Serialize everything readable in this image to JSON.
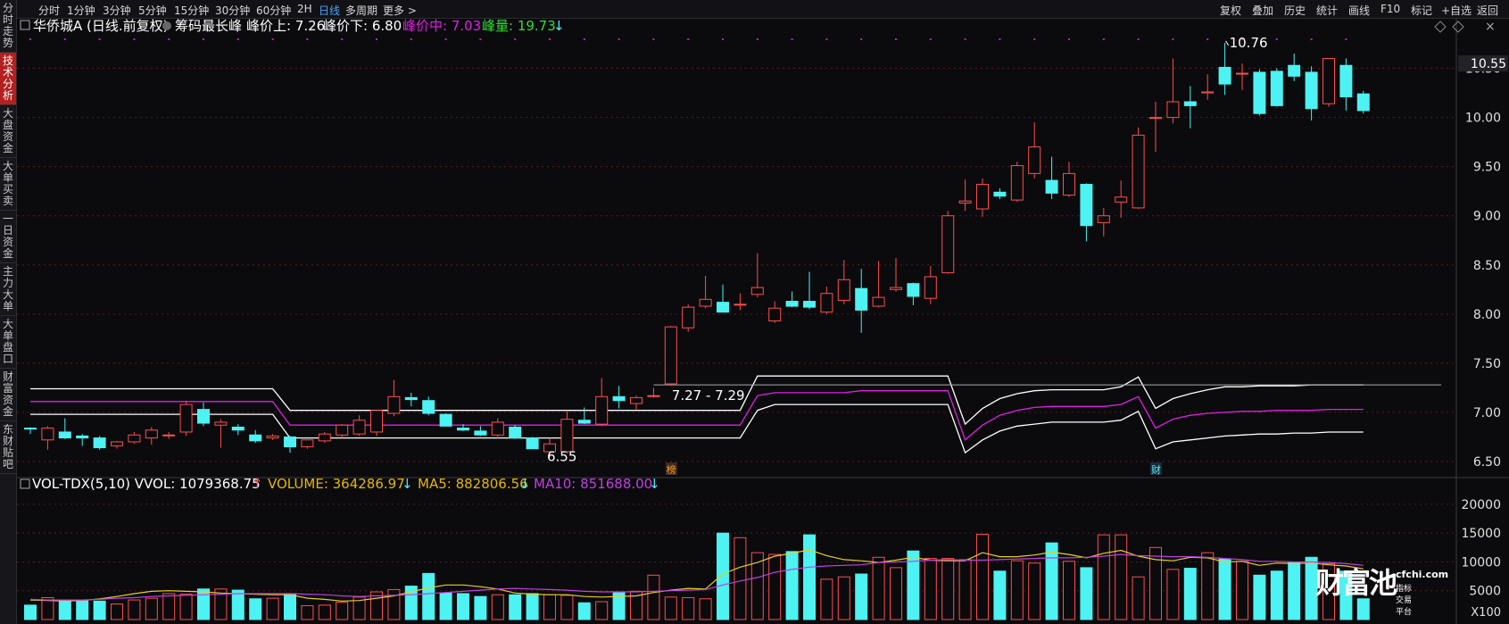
{
  "sidebar": {
    "tabs": [
      {
        "label": "分时走势",
        "active": false
      },
      {
        "label": "技术分析",
        "active": true
      },
      {
        "label": "大盘资金",
        "active": false
      },
      {
        "label": "大单买卖",
        "active": false
      },
      {
        "label": "一日资金",
        "active": false
      },
      {
        "label": "主力大单",
        "active": false
      },
      {
        "label": "大单盘口",
        "active": false
      },
      {
        "label": "财富资金",
        "active": false
      },
      {
        "label": "东财贴吧",
        "active": false
      }
    ]
  },
  "toolbar": {
    "periods": [
      "分时",
      "1分钟",
      "3分钟",
      "5分钟",
      "15分钟",
      "30分钟",
      "60分钟",
      "2H",
      "日线",
      "多周期",
      "更多 >"
    ],
    "active_period": "日线",
    "right_items": [
      "复权",
      "叠加",
      "历史",
      "统计",
      "画线",
      "F10",
      "标记",
      "+自选",
      "返回"
    ]
  },
  "main_header": {
    "stock": "华侨城A (日线.前复权)",
    "indicator": "筹码最长峰",
    "upper_label": "峰价上: 7.26",
    "lower_label": "峰价下: 6.80",
    "mid_label": "峰价中: 7.03",
    "volume_label": "峰量: 19.73",
    "arrow": "↓"
  },
  "annotations": {
    "high_label": "10.76",
    "low_label": "6.55",
    "range_label": "7.27 - 7.29",
    "event1": "榜",
    "event2": "财",
    "current_price": "10.55"
  },
  "price_axis": [
    "10.50",
    "10.00",
    "9.50",
    "9.00",
    "8.50",
    "8.00",
    "7.50",
    "7.00",
    "6.50"
  ],
  "volume_header": {
    "name": "VOL-TDX(5,10) VVOL: 1079368.75",
    "arrow1": "↑",
    "volume": "VOLUME: 364286.97",
    "arrow2": "↓",
    "ma5": "MA5: 882806.56",
    "arrow3": "↓",
    "ma10": "MA10: 851688.00",
    "arrow4": "↓"
  },
  "volume_axis": [
    "20000",
    "15000",
    "10000",
    "5000",
    "X100"
  ],
  "watermark": {
    "main": "财富池",
    "site": "cfchi.com",
    "sub": "指标交易平台"
  },
  "colors": {
    "up": "#ff4d4d",
    "down": "#4df2f2",
    "mid": "#e020e0",
    "band": "#ffffff",
    "ma5": "#e6d020",
    "ma10": "#c040e0",
    "volume_header": "#e6b800",
    "accent": "#49a3ff"
  },
  "chart_data": {
    "type": "candlestick",
    "ylim": [
      6.4,
      10.85
    ],
    "candles": [
      {
        "o": 6.84,
        "h": 6.85,
        "l": 6.78,
        "c": 6.83
      },
      {
        "o": 6.72,
        "h": 6.86,
        "l": 6.62,
        "c": 6.84
      },
      {
        "o": 6.8,
        "h": 6.94,
        "l": 6.73,
        "c": 6.74
      },
      {
        "o": 6.76,
        "h": 6.78,
        "l": 6.66,
        "c": 6.74
      },
      {
        "o": 6.74,
        "h": 6.76,
        "l": 6.62,
        "c": 6.64
      },
      {
        "o": 6.66,
        "h": 6.71,
        "l": 6.63,
        "c": 6.7
      },
      {
        "o": 6.7,
        "h": 6.8,
        "l": 6.68,
        "c": 6.77
      },
      {
        "o": 6.74,
        "h": 6.85,
        "l": 6.67,
        "c": 6.82
      },
      {
        "o": 6.77,
        "h": 6.8,
        "l": 6.73,
        "c": 6.77
      },
      {
        "o": 6.8,
        "h": 7.12,
        "l": 6.76,
        "c": 7.08
      },
      {
        "o": 7.03,
        "h": 7.1,
        "l": 6.86,
        "c": 6.89
      },
      {
        "o": 6.87,
        "h": 6.93,
        "l": 6.64,
        "c": 6.9
      },
      {
        "o": 6.85,
        "h": 6.88,
        "l": 6.77,
        "c": 6.82
      },
      {
        "o": 6.77,
        "h": 6.82,
        "l": 6.69,
        "c": 6.71
      },
      {
        "o": 6.74,
        "h": 6.78,
        "l": 6.72,
        "c": 6.76
      },
      {
        "o": 6.75,
        "h": 6.76,
        "l": 6.59,
        "c": 6.65
      },
      {
        "o": 6.65,
        "h": 6.72,
        "l": 6.63,
        "c": 6.72
      },
      {
        "o": 6.71,
        "h": 6.8,
        "l": 6.69,
        "c": 6.78
      },
      {
        "o": 6.77,
        "h": 6.88,
        "l": 6.74,
        "c": 6.87
      },
      {
        "o": 6.78,
        "h": 6.97,
        "l": 6.76,
        "c": 6.92
      },
      {
        "o": 6.8,
        "h": 7.02,
        "l": 6.76,
        "c": 7.02
      },
      {
        "o": 6.99,
        "h": 7.33,
        "l": 6.96,
        "c": 7.16
      },
      {
        "o": 7.15,
        "h": 7.2,
        "l": 7.06,
        "c": 7.13
      },
      {
        "o": 7.12,
        "h": 7.16,
        "l": 6.97,
        "c": 6.99
      },
      {
        "o": 6.98,
        "h": 6.99,
        "l": 6.86,
        "c": 6.86
      },
      {
        "o": 6.84,
        "h": 6.88,
        "l": 6.81,
        "c": 6.82
      },
      {
        "o": 6.81,
        "h": 6.86,
        "l": 6.76,
        "c": 6.77
      },
      {
        "o": 6.77,
        "h": 6.94,
        "l": 6.73,
        "c": 6.9
      },
      {
        "o": 6.85,
        "h": 6.87,
        "l": 6.73,
        "c": 6.74
      },
      {
        "o": 6.74,
        "h": 6.75,
        "l": 6.63,
        "c": 6.63
      },
      {
        "o": 6.6,
        "h": 6.74,
        "l": 6.55,
        "c": 6.68
      },
      {
        "o": 6.6,
        "h": 7.02,
        "l": 6.58,
        "c": 6.93
      },
      {
        "o": 6.92,
        "h": 7.05,
        "l": 6.88,
        "c": 6.89
      },
      {
        "o": 6.88,
        "h": 7.35,
        "l": 6.86,
        "c": 7.16
      },
      {
        "o": 7.16,
        "h": 7.27,
        "l": 7.04,
        "c": 7.12
      },
      {
        "o": 7.09,
        "h": 7.17,
        "l": 7.03,
        "c": 7.15
      },
      {
        "o": 7.17,
        "h": 7.25,
        "l": 7.15,
        "c": 7.17
      },
      {
        "o": 7.29,
        "h": 7.88,
        "l": 7.27,
        "c": 7.87
      },
      {
        "o": 7.86,
        "h": 8.1,
        "l": 7.82,
        "c": 8.07
      },
      {
        "o": 8.08,
        "h": 8.39,
        "l": 8.06,
        "c": 8.15
      },
      {
        "o": 8.12,
        "h": 8.3,
        "l": 8.03,
        "c": 8.02
      },
      {
        "o": 8.1,
        "h": 8.21,
        "l": 8.04,
        "c": 8.1
      },
      {
        "o": 8.2,
        "h": 8.62,
        "l": 8.17,
        "c": 8.27
      },
      {
        "o": 7.93,
        "h": 8.13,
        "l": 7.91,
        "c": 8.06
      },
      {
        "o": 8.13,
        "h": 8.23,
        "l": 8.07,
        "c": 8.08
      },
      {
        "o": 8.13,
        "h": 8.43,
        "l": 8.05,
        "c": 8.07
      },
      {
        "o": 8.02,
        "h": 8.28,
        "l": 8.0,
        "c": 8.21
      },
      {
        "o": 8.14,
        "h": 8.55,
        "l": 8.1,
        "c": 8.35
      },
      {
        "o": 8.26,
        "h": 8.46,
        "l": 7.81,
        "c": 8.04
      },
      {
        "o": 8.08,
        "h": 8.54,
        "l": 8.07,
        "c": 8.17
      },
      {
        "o": 8.25,
        "h": 8.57,
        "l": 8.23,
        "c": 8.27
      },
      {
        "o": 8.31,
        "h": 8.32,
        "l": 8.09,
        "c": 8.18
      },
      {
        "o": 8.16,
        "h": 8.49,
        "l": 8.1,
        "c": 8.38
      },
      {
        "o": 8.42,
        "h": 9.05,
        "l": 8.41,
        "c": 9.0
      },
      {
        "o": 9.13,
        "h": 9.37,
        "l": 9.05,
        "c": 9.15
      },
      {
        "o": 9.07,
        "h": 9.38,
        "l": 8.99,
        "c": 9.32
      },
      {
        "o": 9.24,
        "h": 9.28,
        "l": 9.17,
        "c": 9.2
      },
      {
        "o": 9.16,
        "h": 9.55,
        "l": 9.14,
        "c": 9.51
      },
      {
        "o": 9.43,
        "h": 9.95,
        "l": 9.38,
        "c": 9.7
      },
      {
        "o": 9.36,
        "h": 9.6,
        "l": 9.17,
        "c": 9.23
      },
      {
        "o": 9.21,
        "h": 9.55,
        "l": 9.19,
        "c": 9.43
      },
      {
        "o": 9.32,
        "h": 9.33,
        "l": 8.74,
        "c": 8.9
      },
      {
        "o": 8.93,
        "h": 9.08,
        "l": 8.79,
        "c": 9.0
      },
      {
        "o": 9.14,
        "h": 9.36,
        "l": 8.98,
        "c": 9.19
      },
      {
        "o": 9.08,
        "h": 9.9,
        "l": 9.07,
        "c": 9.82
      },
      {
        "o": 9.99,
        "h": 10.16,
        "l": 9.65,
        "c": 10.0
      },
      {
        "o": 10.0,
        "h": 10.6,
        "l": 9.94,
        "c": 10.16
      },
      {
        "o": 10.16,
        "h": 10.32,
        "l": 9.89,
        "c": 10.12
      },
      {
        "o": 10.25,
        "h": 10.44,
        "l": 10.18,
        "c": 10.26
      },
      {
        "o": 10.51,
        "h": 10.76,
        "l": 10.23,
        "c": 10.34
      },
      {
        "o": 10.45,
        "h": 10.55,
        "l": 10.28,
        "c": 10.45
      },
      {
        "o": 10.46,
        "h": 10.49,
        "l": 10.02,
        "c": 10.04
      },
      {
        "o": 10.47,
        "h": 10.5,
        "l": 10.11,
        "c": 10.12
      },
      {
        "o": 10.53,
        "h": 10.65,
        "l": 10.37,
        "c": 10.42
      },
      {
        "o": 10.46,
        "h": 10.52,
        "l": 9.97,
        "c": 10.09
      },
      {
        "o": 10.14,
        "h": 10.6,
        "l": 10.11,
        "c": 10.6
      },
      {
        "o": 10.53,
        "h": 10.6,
        "l": 10.07,
        "c": 10.21
      },
      {
        "o": 10.24,
        "h": 10.27,
        "l": 10.04,
        "c": 10.07
      }
    ],
    "band_upper": [
      7.24,
      7.24,
      7.24,
      7.24,
      7.24,
      7.24,
      7.24,
      7.24,
      7.24,
      7.24,
      7.24,
      7.24,
      7.24,
      7.24,
      7.24,
      7.02,
      7.02,
      7.02,
      7.02,
      7.02,
      7.02,
      7.02,
      7.02,
      7.02,
      7.02,
      7.02,
      7.02,
      7.02,
      7.02,
      7.02,
      7.02,
      7.02,
      7.02,
      7.02,
      7.02,
      7.02,
      7.02,
      7.02,
      7.02,
      7.02,
      7.02,
      7.02,
      7.37,
      7.37,
      7.37,
      7.37,
      7.37,
      7.37,
      7.37,
      7.37,
      7.37,
      7.37,
      7.37,
      7.37,
      6.88,
      7.04,
      7.14,
      7.19,
      7.22,
      7.23,
      7.23,
      7.23,
      7.23,
      7.26,
      7.36,
      7.04,
      7.14,
      7.19,
      7.23,
      7.26,
      7.26,
      7.27,
      7.27,
      7.27,
      7.28,
      7.28,
      7.28,
      7.28
    ],
    "band_mid": [
      7.11,
      7.11,
      7.11,
      7.11,
      7.11,
      7.11,
      7.11,
      7.11,
      7.11,
      7.11,
      7.11,
      7.11,
      7.11,
      7.11,
      7.11,
      6.87,
      6.87,
      6.87,
      6.87,
      6.87,
      6.87,
      6.87,
      6.87,
      6.87,
      6.87,
      6.87,
      6.87,
      6.87,
      6.87,
      6.87,
      6.87,
      6.87,
      6.87,
      6.87,
      6.87,
      6.87,
      6.87,
      6.87,
      6.87,
      6.87,
      6.87,
      6.87,
      7.17,
      7.2,
      7.2,
      7.2,
      7.2,
      7.2,
      7.22,
      7.22,
      7.22,
      7.22,
      7.22,
      7.22,
      6.72,
      6.87,
      6.97,
      7.02,
      7.05,
      7.06,
      7.06,
      7.06,
      7.06,
      7.08,
      7.16,
      6.84,
      6.93,
      6.97,
      6.99,
      7.0,
      7.01,
      7.01,
      7.02,
      7.02,
      7.02,
      7.03,
      7.03,
      7.03
    ],
    "band_lower": [
      6.98,
      6.98,
      6.98,
      6.98,
      6.98,
      6.98,
      6.98,
      6.98,
      6.98,
      6.98,
      6.98,
      6.98,
      6.98,
      6.98,
      6.98,
      6.74,
      6.74,
      6.74,
      6.74,
      6.74,
      6.74,
      6.74,
      6.74,
      6.74,
      6.74,
      6.74,
      6.74,
      6.74,
      6.74,
      6.74,
      6.74,
      6.74,
      6.74,
      6.74,
      6.74,
      6.74,
      6.74,
      6.74,
      6.74,
      6.74,
      6.74,
      6.74,
      7.02,
      7.08,
      7.08,
      7.08,
      7.08,
      7.08,
      7.08,
      7.08,
      7.08,
      7.08,
      7.08,
      7.08,
      6.59,
      6.72,
      6.81,
      6.86,
      6.88,
      6.9,
      6.9,
      6.9,
      6.9,
      6.92,
      7.01,
      6.63,
      6.7,
      6.72,
      6.74,
      6.76,
      6.77,
      6.78,
      6.78,
      6.79,
      6.79,
      6.8,
      6.8,
      6.8
    ],
    "volume": [
      2500,
      3800,
      3300,
      3300,
      3200,
      2700,
      3400,
      3700,
      4500,
      4400,
      5300,
      5300,
      5100,
      3600,
      3700,
      4500,
      2400,
      2500,
      3000,
      3900,
      4800,
      5200,
      5800,
      8000,
      4600,
      4500,
      4000,
      4300,
      4300,
      4500,
      4300,
      4200,
      2900,
      3100,
      4800,
      4900,
      7700,
      3900,
      3800,
      3600,
      15000,
      14200,
      11600,
      11300,
      11800,
      14700,
      7000,
      7400,
      7900,
      10800,
      9000,
      11900,
      10600,
      10600,
      10400,
      14800,
      8400,
      10200,
      9800,
      13300,
      10100,
      9000,
      14700,
      14700,
      7400,
      12500,
      8700,
      8900,
      11600,
      10500,
      10100,
      7700,
      8400,
      9900,
      10800,
      9700,
      8400,
      3600
    ],
    "volume_ylim": [
      0,
      22000
    ],
    "ma5": [
      3400,
      3300,
      3200,
      3300,
      3600,
      4000,
      4500,
      4900,
      5000,
      4900,
      4800,
      4600,
      4500,
      4400,
      4300,
      4300,
      3700,
      3500,
      3200,
      3300,
      3700,
      4100,
      4800,
      5500,
      6000,
      6000,
      5700,
      5300,
      4600,
      4400,
      4300,
      4300,
      4000,
      3900,
      4000,
      4100,
      4700,
      5100,
      5400,
      5300,
      7900,
      9100,
      9900,
      11000,
      11500,
      12100,
      11100,
      10400,
      10200,
      9900,
      10300,
      10800,
      10300,
      10200,
      10200,
      11600,
      10900,
      10900,
      11200,
      11700,
      11300,
      10700,
      11500,
      12000,
      11000,
      10400,
      10200,
      10800,
      10700,
      10000,
      10100,
      9400,
      9800,
      9700,
      9800,
      9500,
      9300,
      8800
    ],
    "ma10": [
      3500,
      3400,
      3400,
      3400,
      3500,
      3700,
      3800,
      4000,
      4100,
      4200,
      4300,
      4400,
      4500,
      4500,
      4500,
      4500,
      4400,
      4300,
      4100,
      4000,
      4100,
      4200,
      4300,
      4500,
      4700,
      4900,
      5100,
      5300,
      5400,
      5300,
      5200,
      5100,
      4900,
      4800,
      4800,
      4800,
      4900,
      5000,
      5100,
      5200,
      6000,
      6700,
      7300,
      8200,
      8700,
      9100,
      9300,
      9400,
      9500,
      9900,
      10000,
      10100,
      10300,
      10400,
      10300,
      10300,
      10400,
      10500,
      10600,
      10700,
      10700,
      10800,
      11000,
      11300,
      11100,
      11000,
      10900,
      10900,
      10800,
      10600,
      10400,
      10100,
      10100,
      10000,
      10000,
      9900,
      9700,
      9400
    ]
  }
}
